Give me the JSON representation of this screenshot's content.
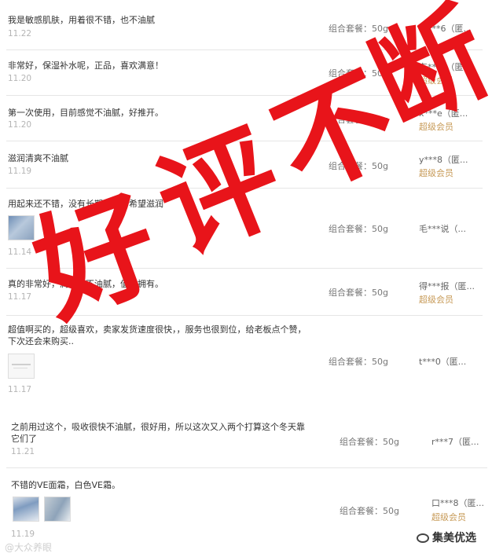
{
  "reviews": [
    {
      "comment": "我是敏感肌肤，用着很不错，也不油腻",
      "date": "11.22",
      "sku": "组合套餐：50g",
      "user": "石***6（匿...",
      "member": ""
    },
    {
      "comment": "非常好，保湿补水呢，正品，喜欢满意！",
      "date": "11.20",
      "sku": "组合套餐：50g",
      "user": "东***3（匿...",
      "member": "超级会员"
    },
    {
      "comment": "第一次使用，目前感觉不油腻，好推开。",
      "date": "11.20",
      "sku": "组合套餐：50g",
      "user": "x***e（匿...",
      "member": "超级会员"
    },
    {
      "comment": "滋润清爽不油腻",
      "date": "11.19",
      "sku": "组合套餐：50g",
      "user": "y***8（匿...",
      "member": "超级会员"
    },
    {
      "comment": "用起来还不错，没有长期使用，希望滋润",
      "date": "11.14",
      "sku": "组合套餐：50g",
      "user": "毛***说（...",
      "member": ""
    },
    {
      "comment": "真的非常好，润肤，不油腻，值得拥有。",
      "date": "11.17",
      "sku": "组合套餐：50g",
      "user": "得***报（匿...",
      "member": "超级会员"
    },
    {
      "comment": "超值啊买的，超级喜欢，卖家发货速度很快，，服务也很到位，给老板点个赞，下次还会来购买..",
      "date": "11.17",
      "sku": "组合套餐：50g",
      "user": "t***0（匿...",
      "member": ""
    },
    {
      "comment": "之前用过这个，吸收很快不油腻，很好用，所以这次又入两个打算这个冬天靠它们了",
      "date": "11.21",
      "sku": "组合套餐：50g",
      "user": "r***7（匿...",
      "member": ""
    },
    {
      "comment": "不错的VE面霜，白色VE霜。",
      "date": "11.19",
      "sku": "组合套餐：50g",
      "user": "口***8（匿...",
      "member": "超级会员"
    }
  ],
  "overlay": {
    "chars": [
      "好",
      "评",
      "不",
      "断"
    ]
  },
  "watermarks": {
    "left": "@大众养眼",
    "right": "集美优选"
  },
  "colors": {
    "stamp": "#e8141a",
    "member": "#c79a57",
    "date": "#b5b5b5"
  }
}
